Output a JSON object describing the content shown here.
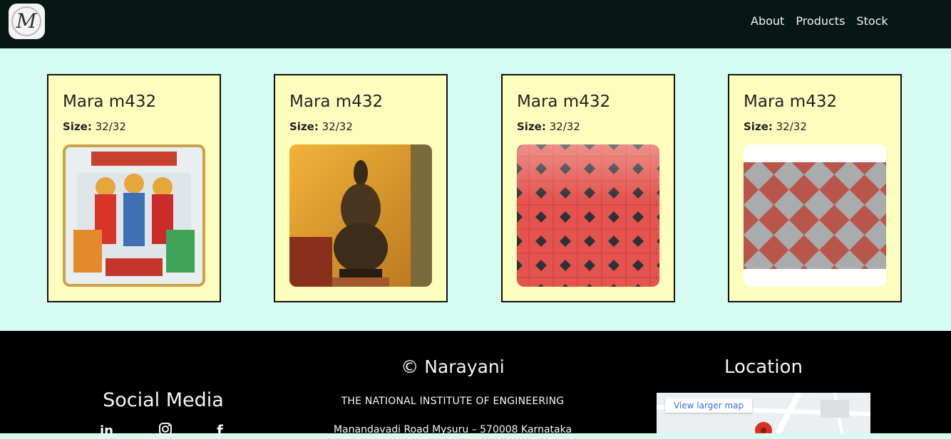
{
  "nav": {
    "links": [
      "About",
      "Products",
      "Stock"
    ]
  },
  "products": [
    {
      "name": "Mara m432",
      "size_label": "Size:",
      "size_value": "32/32"
    },
    {
      "name": "Mara m432",
      "size_label": "Size:",
      "size_value": "32/32"
    },
    {
      "name": "Mara m432",
      "size_label": "Size:",
      "size_value": "32/32"
    },
    {
      "name": "Mara m432",
      "size_label": "Size:",
      "size_value": "32/32"
    }
  ],
  "footer": {
    "social_title": "Social Media",
    "copyright": "© Narayani",
    "institution": "THE NATIONAL INSTITUTE OF ENGINEERING",
    "address": "Manandavadi Road Mysuru – 570008 Karnataka",
    "location_title": "Location",
    "map_link": "View larger map",
    "social_icons": [
      "linkedin-icon",
      "instagram-icon",
      "facebook-icon"
    ]
  },
  "colors": {
    "nav_bg": "#071713",
    "page_bg": "#d6fcf2",
    "card_bg": "#fdfdbe",
    "footer_bg": "#000000"
  }
}
